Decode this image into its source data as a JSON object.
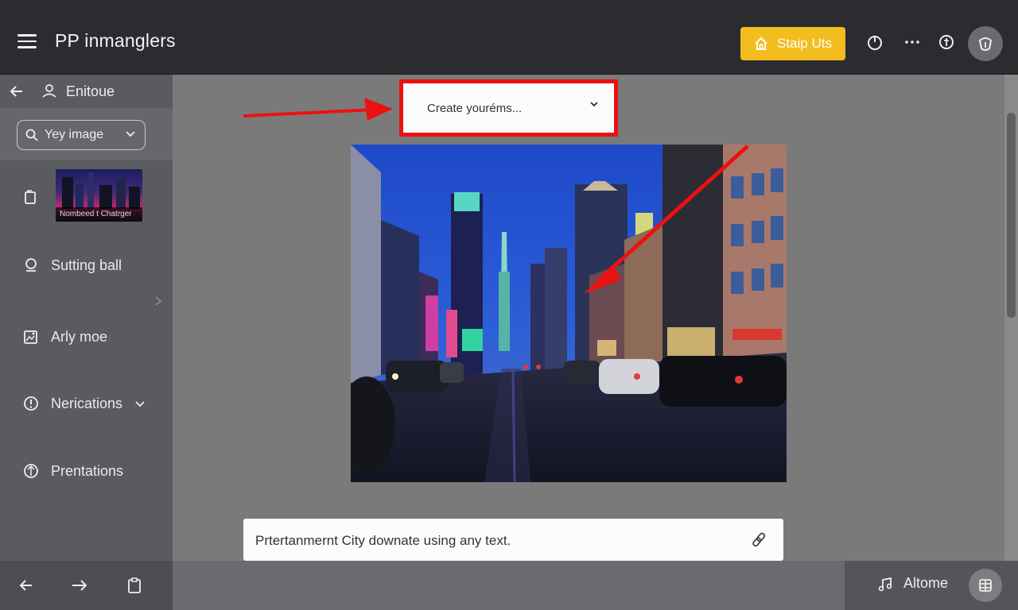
{
  "app": {
    "title": "PP inmanglers"
  },
  "topbar": {
    "upgrade_label": "Staip Uts",
    "icons": [
      "menu-icon",
      "home-icon",
      "power-icon",
      "more-icon",
      "coin-icon",
      "avatar-icon"
    ]
  },
  "sidebar": {
    "header_label": "Enitoue",
    "search_value": "Yey image",
    "thumbnail_caption": "Nombeed t Chatrger",
    "items": [
      {
        "label": "Sutting ball",
        "icon": "bulb-icon"
      },
      {
        "label": "Arly moe",
        "icon": "image-edit-icon"
      },
      {
        "label": "Nerications",
        "icon": "info-icon",
        "has_chevron": true
      },
      {
        "label": "Prentations",
        "icon": "shield-icon"
      }
    ]
  },
  "main": {
    "dropdown_label": "Create youréms...",
    "prompt_text": "Prtertanmernt City downate using any text."
  },
  "bottombar": {
    "home_label": "Altome"
  },
  "colors": {
    "accent": "#f3bd1f",
    "annotation_red": "#ec1111",
    "topbar_bg": "#2a2c30"
  }
}
